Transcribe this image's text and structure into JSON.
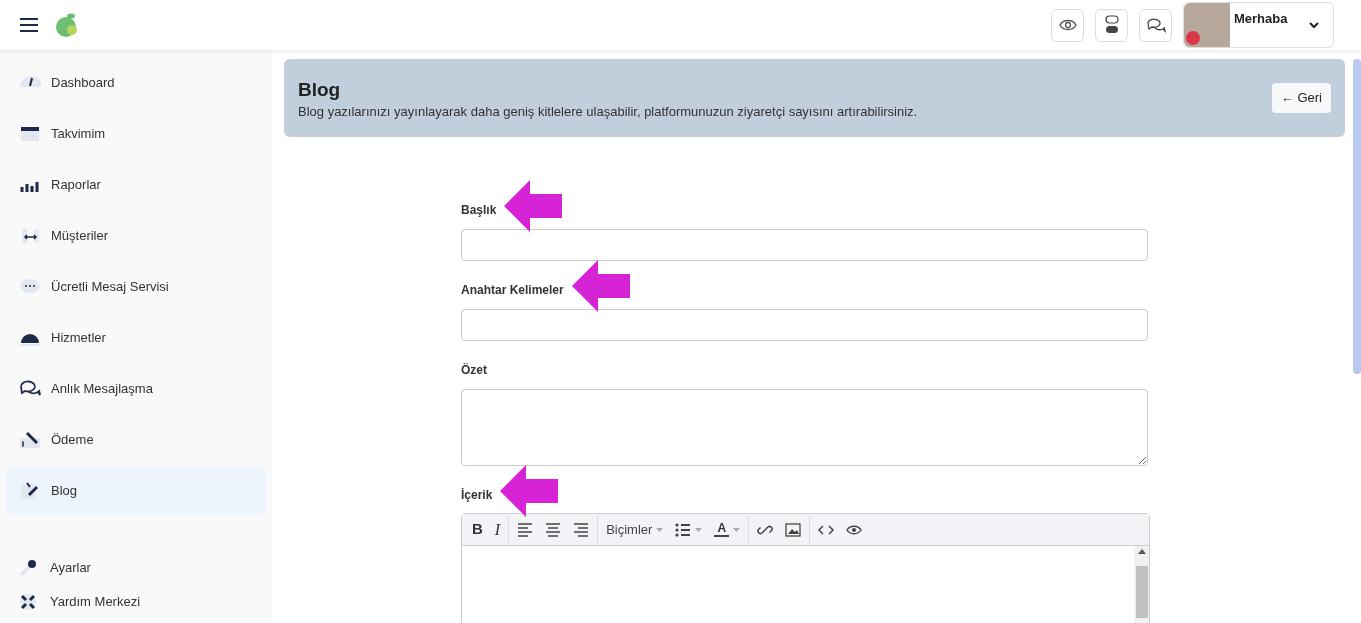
{
  "header": {
    "greeting": "Merhaba"
  },
  "sidebar": {
    "items": [
      {
        "label": "Dashboard",
        "selected": false
      },
      {
        "label": "Takvimim",
        "selected": false
      },
      {
        "label": "Raporlar",
        "selected": false
      },
      {
        "label": "Müşteriler",
        "selected": false
      },
      {
        "label": "Ücretli Mesaj Servisi",
        "selected": false
      },
      {
        "label": "Hizmetler",
        "selected": false
      },
      {
        "label": "Anlık Mesajlaşma",
        "selected": false
      },
      {
        "label": "Ödeme",
        "selected": false
      },
      {
        "label": "Blog",
        "selected": true
      }
    ],
    "footer_items": [
      {
        "label": "Ayarlar"
      },
      {
        "label": "Yardım Merkezi"
      }
    ]
  },
  "banner": {
    "title": "Blog",
    "subtitle": "Blog yazılarınızı yayınlayarak daha geniş kitlelere ulaşabilir, platformunuzun ziyaretçi sayısını artırabilirsiniz.",
    "back_button": "← Geri"
  },
  "form": {
    "fields": [
      {
        "label": "Başlık",
        "kind": "input",
        "marked": true
      },
      {
        "label": "Anahtar Kelimeler",
        "kind": "input",
        "marked": true
      },
      {
        "label": "Özet",
        "kind": "textarea",
        "marked": false
      },
      {
        "label": "İçerik",
        "kind": "editor",
        "marked": true
      }
    ],
    "toolbar": [
      [
        {
          "kind": "bold",
          "label": "B"
        },
        {
          "kind": "italic",
          "label": "I"
        }
      ],
      [
        {
          "kind": "align-left"
        },
        {
          "kind": "align-center"
        },
        {
          "kind": "align-right"
        }
      ],
      [
        {
          "kind": "formats",
          "label": "Biçimler"
        },
        {
          "kind": "list"
        },
        {
          "kind": "color",
          "label": "A"
        }
      ],
      [
        {
          "kind": "link"
        },
        {
          "kind": "image"
        }
      ],
      [
        {
          "kind": "code"
        },
        {
          "kind": "preview"
        }
      ]
    ]
  }
}
